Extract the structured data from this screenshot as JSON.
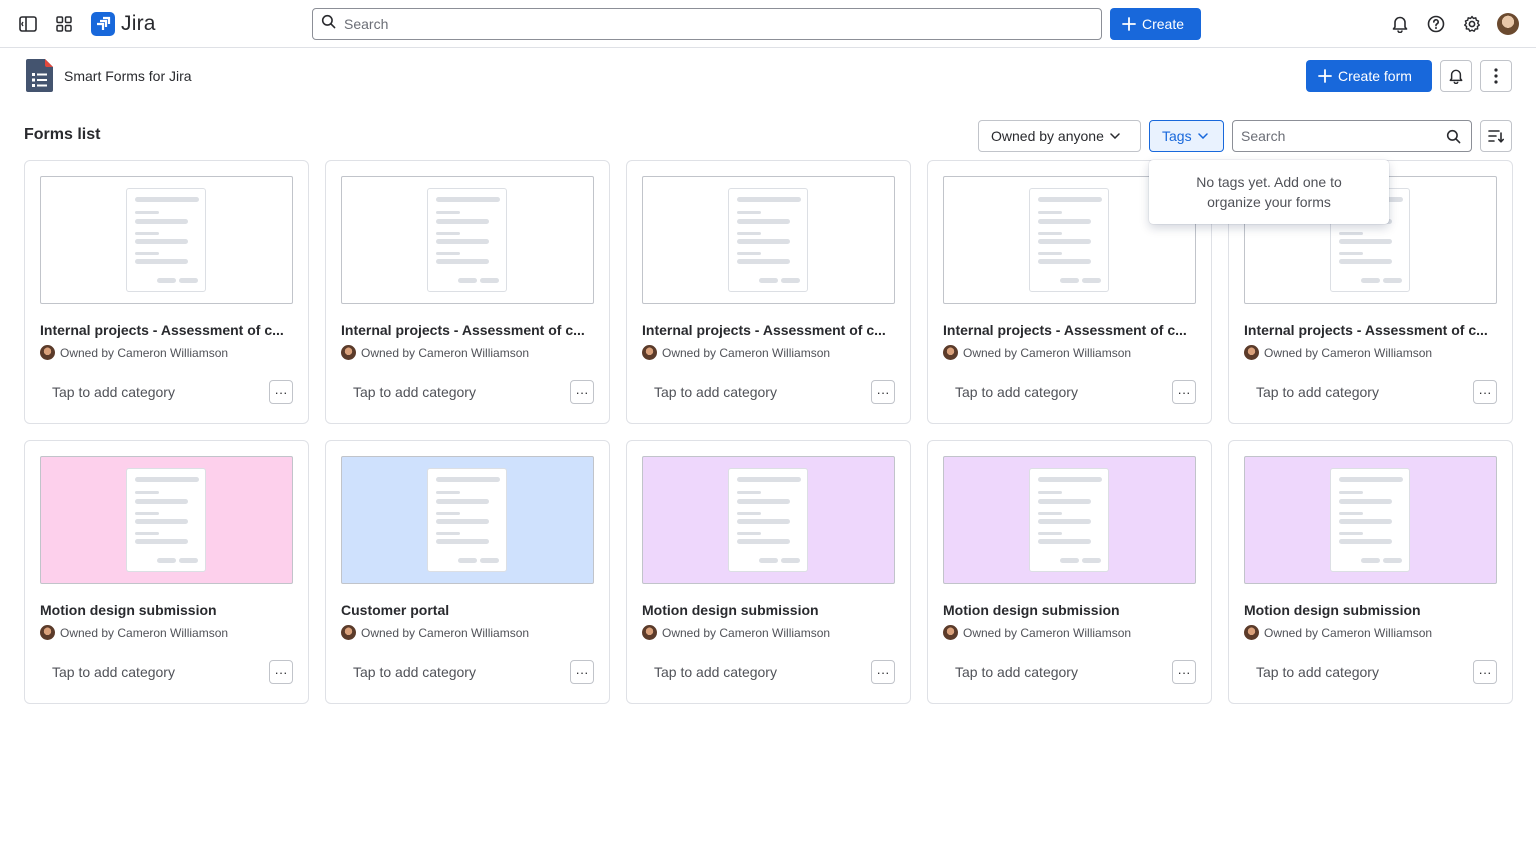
{
  "topnav": {
    "brand": "Jira",
    "search_placeholder": "Search",
    "create_label": "Create"
  },
  "app": {
    "title": "Smart Forms for Jira",
    "create_form_label": "Create form"
  },
  "toolbar": {
    "list_title": "Forms list",
    "owner_filter_label": "Owned by anyone",
    "tags_filter_label": "Tags",
    "search_placeholder": "Search"
  },
  "tags_popover": {
    "message": "No tags yet. Add one to organize your forms"
  },
  "colors": {
    "brand": "#1868db",
    "thumb_pink": "#fdd0ec",
    "thumb_blue": "#cfe1fd",
    "thumb_purple": "#eed7fc",
    "thumb_blank": "#ffffff"
  },
  "forms": [
    {
      "title": "Internal projects - Assessment of c...",
      "owner": "Owned by Cameron Williamson",
      "category": "Tap to add category",
      "more": "···",
      "thumb_color": "#ffffff"
    },
    {
      "title": "Internal projects - Assessment of c...",
      "owner": "Owned by Cameron Williamson",
      "category": "Tap to add category",
      "more": "···",
      "thumb_color": "#ffffff"
    },
    {
      "title": "Internal projects - Assessment of c...",
      "owner": "Owned by Cameron Williamson",
      "category": "Tap to add category",
      "more": "···",
      "thumb_color": "#ffffff"
    },
    {
      "title": "Internal projects - Assessment of c...",
      "owner": "Owned by Cameron Williamson",
      "category": "Tap to add category",
      "more": "···",
      "thumb_color": "#ffffff"
    },
    {
      "title": "Internal projects - Assessment of c...",
      "owner": "Owned by Cameron Williamson",
      "category": "Tap to add category",
      "more": "···",
      "thumb_color": "#ffffff"
    },
    {
      "title": "Motion design submission",
      "owner": "Owned by Cameron Williamson",
      "category": "Tap to add category",
      "more": "···",
      "thumb_color": "#fdd0ec"
    },
    {
      "title": "Customer portal",
      "owner": "Owned by Cameron Williamson",
      "category": "Tap to add category",
      "more": "···",
      "thumb_color": "#cfe1fd"
    },
    {
      "title": "Motion design submission",
      "owner": "Owned by Cameron Williamson",
      "category": "Tap to add category",
      "more": "···",
      "thumb_color": "#eed7fc"
    },
    {
      "title": "Motion design submission",
      "owner": "Owned by Cameron Williamson",
      "category": "Tap to add category",
      "more": "···",
      "thumb_color": "#eed7fc"
    },
    {
      "title": "Motion design submission",
      "owner": "Owned by Cameron Williamson",
      "category": "Tap to add category",
      "more": "···",
      "thumb_color": "#eed7fc"
    }
  ]
}
